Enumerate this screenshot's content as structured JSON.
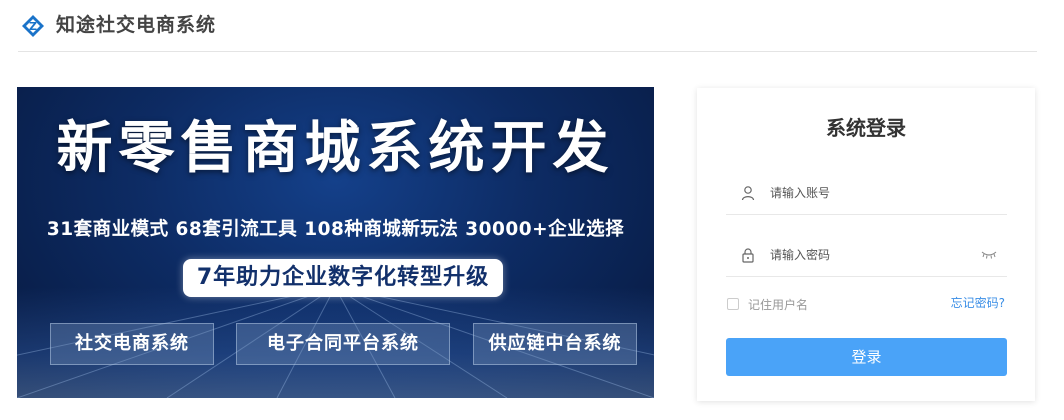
{
  "header": {
    "title": "知途社交电商系统",
    "logo_icon": "z-logo-icon",
    "brand_color": "#1a73c9"
  },
  "banner": {
    "headline": "新零售商城系统开发",
    "subline": "31套商业模式 68套引流工具 108种商城新玩法 30000+企业选择",
    "pill": "7年助力企业数字化转型升级",
    "tags": [
      "社交电商系统",
      "电子合同平台系统",
      "供应链中台系统"
    ]
  },
  "login": {
    "title": "系统登录",
    "username": {
      "placeholder": "请输入账号",
      "value": "",
      "icon": "user-icon"
    },
    "password": {
      "placeholder": "请输入密码",
      "value": "",
      "icon": "lock-icon",
      "toggle_icon": "eye-closed-icon"
    },
    "remember_label": "记住用户名",
    "remember_checked": false,
    "forgot_label": "忘记密码?",
    "submit_label": "登录",
    "accent_color": "#4aa3f8"
  }
}
